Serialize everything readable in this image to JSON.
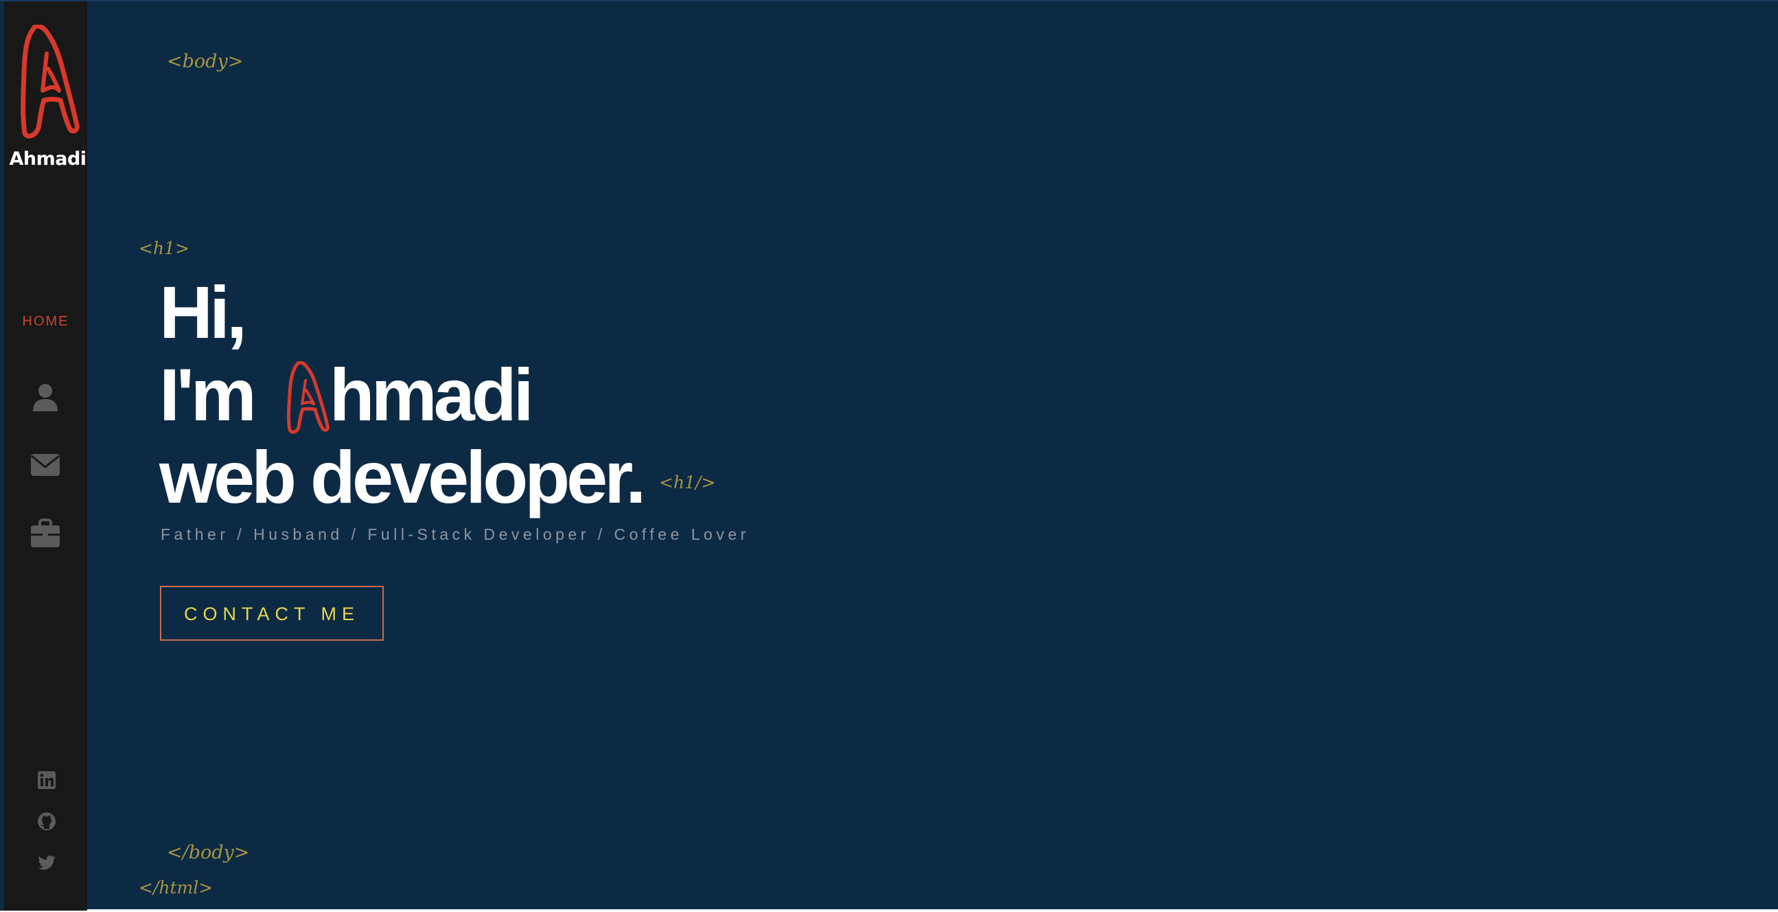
{
  "sidebar": {
    "logo_text": "Ahmadi",
    "nav_home": "HOME",
    "nav_icons": [
      "user-icon",
      "envelope-icon",
      "briefcase-icon"
    ],
    "social_icons": [
      "linkedin-icon",
      "github-icon",
      "twitter-icon"
    ]
  },
  "decor_tags": {
    "body_open": "<body>",
    "h1_open": "<h1>",
    "h1_close": "<h1/>",
    "body_close": "</body>",
    "html_close": "</html>"
  },
  "hero": {
    "line1": "Hi,",
    "line2_prefix": "I'm",
    "line2_suffix": "hmadi",
    "line3": "web developer."
  },
  "subtitle": "Father / Husband / Full-Stack Developer / Coffee Lover",
  "contact_button": "CONTACT ME",
  "colors": {
    "background": "#0d2a45",
    "sidebar": "#181818",
    "accent_red": "#d8392b",
    "home_active": "#c8482c",
    "tag_gold": "#a6953f",
    "button_text": "#ecd64a",
    "button_border": "#c86c4d",
    "icon_gray": "#5b5b5b"
  }
}
